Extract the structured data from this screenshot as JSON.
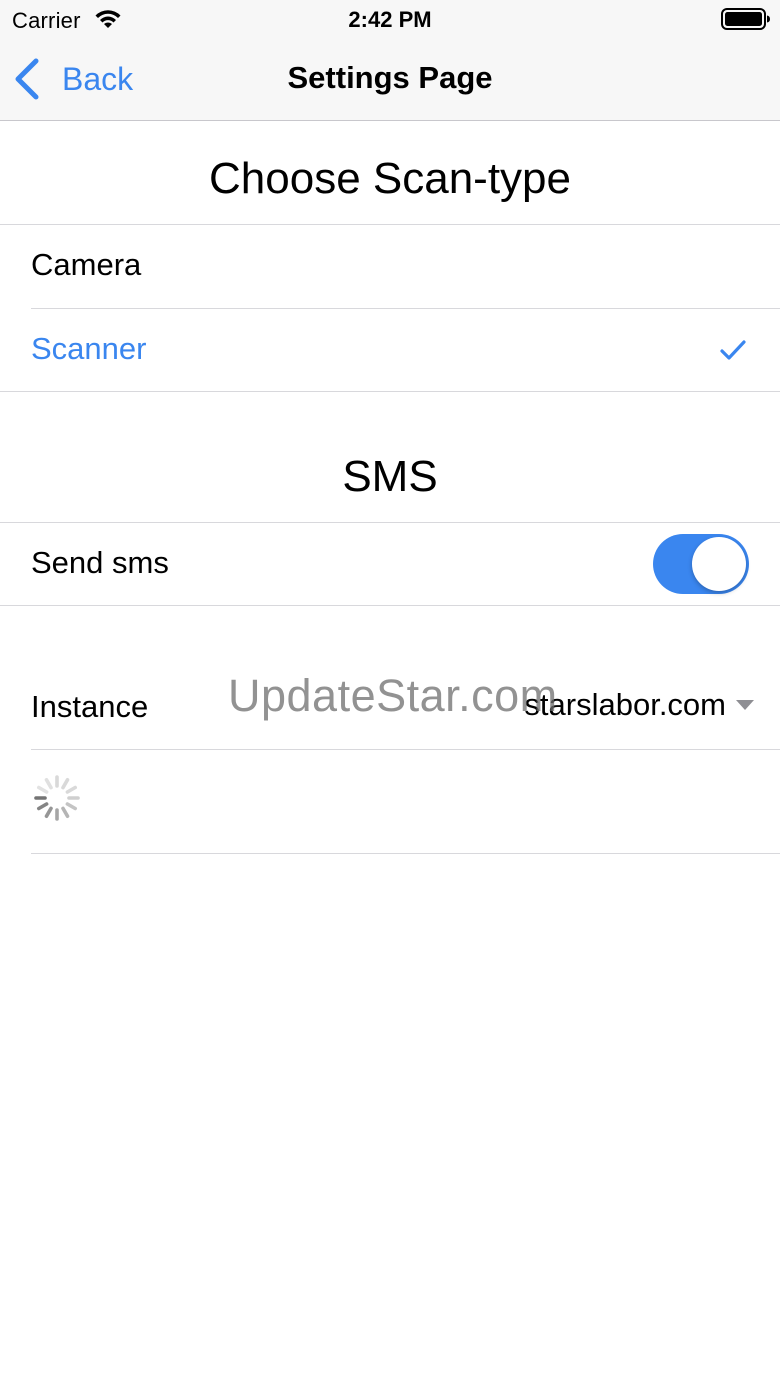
{
  "status_bar": {
    "carrier": "Carrier",
    "time": "2:42 PM",
    "icons": [
      "wifi-icon",
      "battery-icon"
    ]
  },
  "nav": {
    "back_label": "Back",
    "title": "Settings Page",
    "back_icon": "chevron-left-icon"
  },
  "scan_section": {
    "header": "Choose Scan-type",
    "options": [
      {
        "label": "Camera",
        "selected": false
      },
      {
        "label": "Scanner",
        "selected": true
      }
    ]
  },
  "sms_section": {
    "header": "SMS",
    "send_sms_label": "Send sms",
    "send_sms_enabled": true
  },
  "instance": {
    "label": "Instance",
    "value": "starslabor.com"
  },
  "watermark": "UpdateStar.com",
  "colors": {
    "accent": "#3a86ef",
    "bar_background": "#f7f7f7",
    "separator": "#d8d8dc"
  }
}
